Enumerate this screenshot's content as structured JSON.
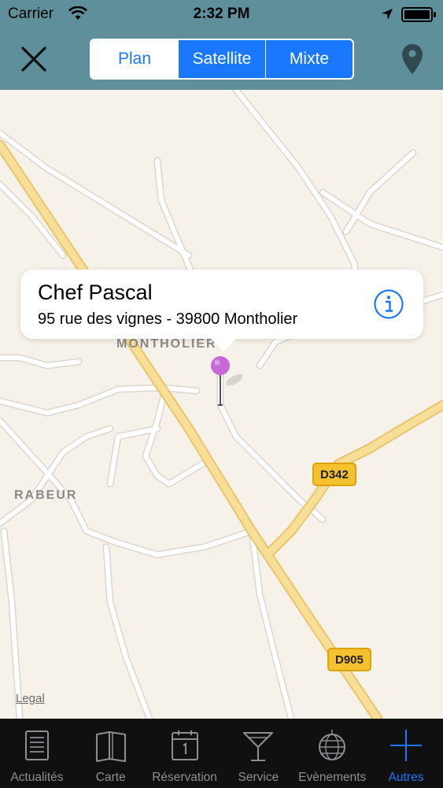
{
  "status_bar": {
    "carrier": "Carrier",
    "time": "2:32 PM"
  },
  "nav": {
    "close_icon": "close-icon",
    "segments": [
      {
        "label": "Plan",
        "selected": true
      },
      {
        "label": "Satellite",
        "selected": false
      },
      {
        "label": "Mixte",
        "selected": false
      }
    ],
    "location_icon": "map-pin-icon"
  },
  "map": {
    "place_labels": [
      "MONTHOLIER",
      "RABEUR"
    ],
    "road_signs": [
      "D342",
      "D905"
    ],
    "legal": "Legal",
    "callout": {
      "title": "Chef Pascal",
      "subtitle": "95 rue des vignes - 39800 Montholier",
      "info_icon": "info-icon"
    },
    "pin_color": "#c86ad6"
  },
  "tabs": [
    {
      "label": "Actualités",
      "icon": "newspaper-icon",
      "active": false
    },
    {
      "label": "Carte",
      "icon": "menu-book-icon",
      "active": false
    },
    {
      "label": "Réservation",
      "icon": "calendar-icon",
      "active": false
    },
    {
      "label": "Service",
      "icon": "cocktail-glass-icon",
      "active": false
    },
    {
      "label": "Evènements",
      "icon": "disco-ball-icon",
      "active": false
    },
    {
      "label": "Autres",
      "icon": "plus-icon",
      "active": true
    }
  ],
  "colors": {
    "nav_background": "#5f8f9b",
    "accent": "#1a78ff",
    "map_background": "#f6f2e9",
    "major_road": "#f6d989",
    "tab_bar": "#101010"
  }
}
